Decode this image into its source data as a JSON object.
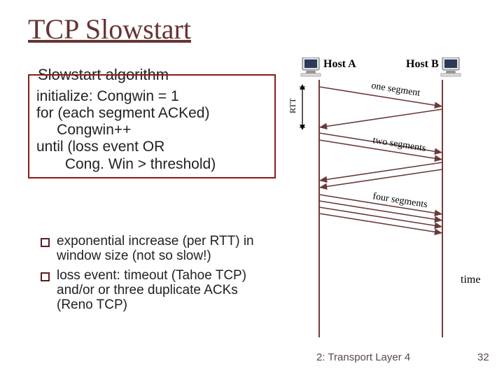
{
  "title": "TCP Slowstart",
  "algorithm": {
    "legend": "Slowstart algorithm",
    "body": "initialize: Congwin = 1\nfor (each segment ACKed)\n     Congwin++\nuntil (loss event OR\n       Cong. Win > threshold)"
  },
  "bullets": [
    "exponential increase (per RTT) in window size (not so slow!)",
    "loss event: timeout (Tahoe TCP) and/or or three duplicate ACKs (Reno TCP)"
  ],
  "diagram": {
    "host_a": "Host A",
    "host_b": "Host B",
    "rtt_label": "RTT",
    "segment_labels": [
      "one segment",
      "two segments",
      "four segments"
    ],
    "time_label": "time"
  },
  "footer": {
    "left": "2: Transport Layer 4",
    "right": "32"
  }
}
